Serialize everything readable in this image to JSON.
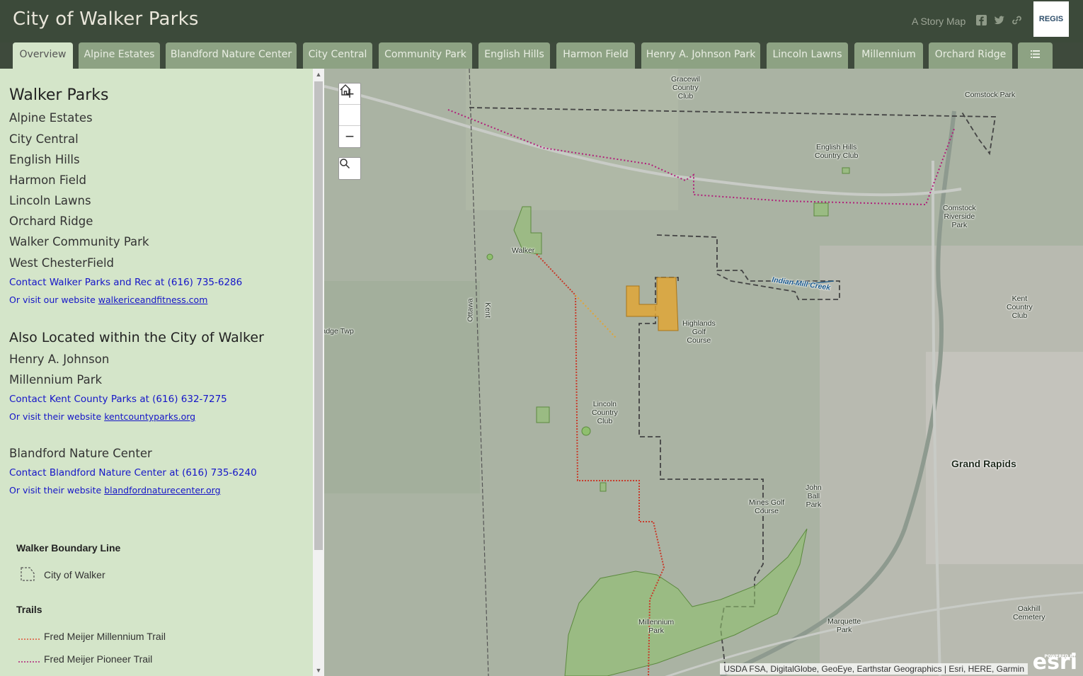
{
  "header": {
    "title": "City of Walker Parks",
    "story_map": "A Story Map",
    "logo_text": "REGIS"
  },
  "tabs": [
    {
      "label": "Overview",
      "active": true
    },
    {
      "label": "Alpine Estates"
    },
    {
      "label": "Blandford Nature Center"
    },
    {
      "label": "City Central"
    },
    {
      "label": "Community Park"
    },
    {
      "label": "English Hills"
    },
    {
      "label": "Harmon Field"
    },
    {
      "label": "Henry A. Johnson Park"
    },
    {
      "label": "Lincoln Lawns"
    },
    {
      "label": "Millennium"
    },
    {
      "label": "Orchard Ridge"
    }
  ],
  "panel": {
    "heading1": "Walker Parks",
    "parks": [
      "Alpine Estates",
      "City Central",
      "English Hills",
      "Harmon Field",
      "Lincoln Lawns",
      "Orchard Ridge",
      "Walker Community Park",
      "West ChesterField"
    ],
    "contact1": "Contact Walker Parks and Rec at (616) 735-6286",
    "visit1_prefix": "Or visit our website ",
    "visit1_link": "walkericeandfitness.com",
    "heading2": "Also Located within the City of Walker",
    "also": [
      "Henry A. Johnson",
      "Millennium Park"
    ],
    "contact2": "Contact Kent County Parks at (616) 632-7275",
    "visit2_prefix": "Or visit their website ",
    "visit2_link": "kentcountyparks.org",
    "blandford": "Blandford Nature Center",
    "contact3": "Contact Blandford Nature Center at (616) 735-6240",
    "visit3_prefix": "Or visit their website ",
    "visit3_link": "blandfordnaturecenter.org"
  },
  "legend": {
    "boundary_heading": "Walker Boundary Line",
    "boundary_item": "City of Walker",
    "trails_heading": "Trails",
    "trail1": "Fred Meijer Millennium Trail",
    "trail2": "Fred Meijer Pioneer Trail",
    "trail1_color": "#e0553a",
    "trail2_color": "#b0207a"
  },
  "map": {
    "labels": {
      "gracewil": "Gracewil\nCountry\nClub",
      "comstock_park": "Comstock Park",
      "english_hills_cc": "English Hills\nCountry Club",
      "comstock_riverside": "Comstock\nRiverside\nPark",
      "walker": "Walker",
      "indian_mill": "Indian Mill Creek",
      "kent_cc": "Kent\nCountry\nClub",
      "highlands": "Highlands\nGolf\nCourse",
      "ottawa": "Ottawa",
      "kent": "Kent",
      "lincoln_cc": "Lincoln\nCountry\nClub",
      "grand_rapids": "Grand Rapids",
      "john_ball": "John\nBall\nPark",
      "mines_golf": "Mines Golf\nCourse",
      "millennium_park": "Millennium\nPark",
      "marquette": "Marquette\nPark",
      "oakhill": "Oakhill\nCemetery",
      "tallmadge": "Tallmadge Twp"
    },
    "attribution": "USDA FSA, DigitalGlobe, GeoEye, Earthstar Geographics | Esri, HERE, Garmin",
    "esri": "esri",
    "powered_by": "POWERED BY"
  }
}
